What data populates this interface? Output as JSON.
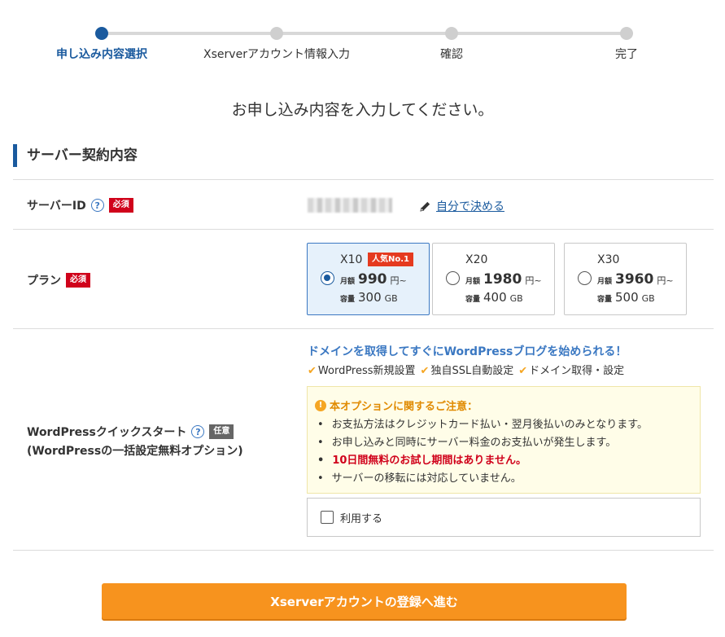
{
  "stepper": {
    "steps": [
      {
        "label": "申し込み内容選択",
        "active": true
      },
      {
        "label": "Xserverアカウント情報入力",
        "active": false
      },
      {
        "label": "確認",
        "active": false
      },
      {
        "label": "完了",
        "active": false
      }
    ]
  },
  "headline": "お申し込み内容を入力してください。",
  "section_title": "サーバー契約内容",
  "server_id": {
    "label": "サーバーID",
    "help": "?",
    "badge": "必須",
    "edit_link": "自分で決める"
  },
  "plan": {
    "label": "プラン",
    "badge": "必須",
    "monthly_label": "月額",
    "capacity_label": "容量",
    "price_unit": "円~",
    "capacity_unit": "GB",
    "options": [
      {
        "name": "X10",
        "popular": "人気No.1",
        "price": "990",
        "capacity": "300",
        "selected": true
      },
      {
        "name": "X20",
        "popular": "",
        "price": "1980",
        "capacity": "400",
        "selected": false
      },
      {
        "name": "X30",
        "popular": "",
        "price": "3960",
        "capacity": "500",
        "selected": false
      }
    ]
  },
  "wp_quick": {
    "label_line1": "WordPressクイックスタート",
    "label_line2": "(WordPressの一括設定無料オプション)",
    "help": "?",
    "badge": "任意",
    "promo": "ドメインを取得してすぐにWordPressブログを始められる！",
    "features": [
      "WordPress新規設置",
      "独自SSL自動設定",
      "ドメイン取得・設定"
    ],
    "caution_title": "本オプションに関するご注意：",
    "caution_items": [
      {
        "text": "お支払方法はクレジットカード払い・翌月後払いのみとなります。",
        "red": false
      },
      {
        "text": "お申し込みと同時にサーバー料金のお支払いが発生します。",
        "red": false
      },
      {
        "text": "10日間無料のお試し期間はありません。",
        "red": true
      },
      {
        "text": "サーバーの移転には対応していません。",
        "red": false
      }
    ],
    "use_label": "利用する"
  },
  "cta_label": "Xserverアカウントの登録へ進む",
  "colors": {
    "accent": "#1a5a9e",
    "cta": "#f7931e",
    "required": "#d0021b",
    "popular": "#e53a1f",
    "check": "#f5a623"
  }
}
